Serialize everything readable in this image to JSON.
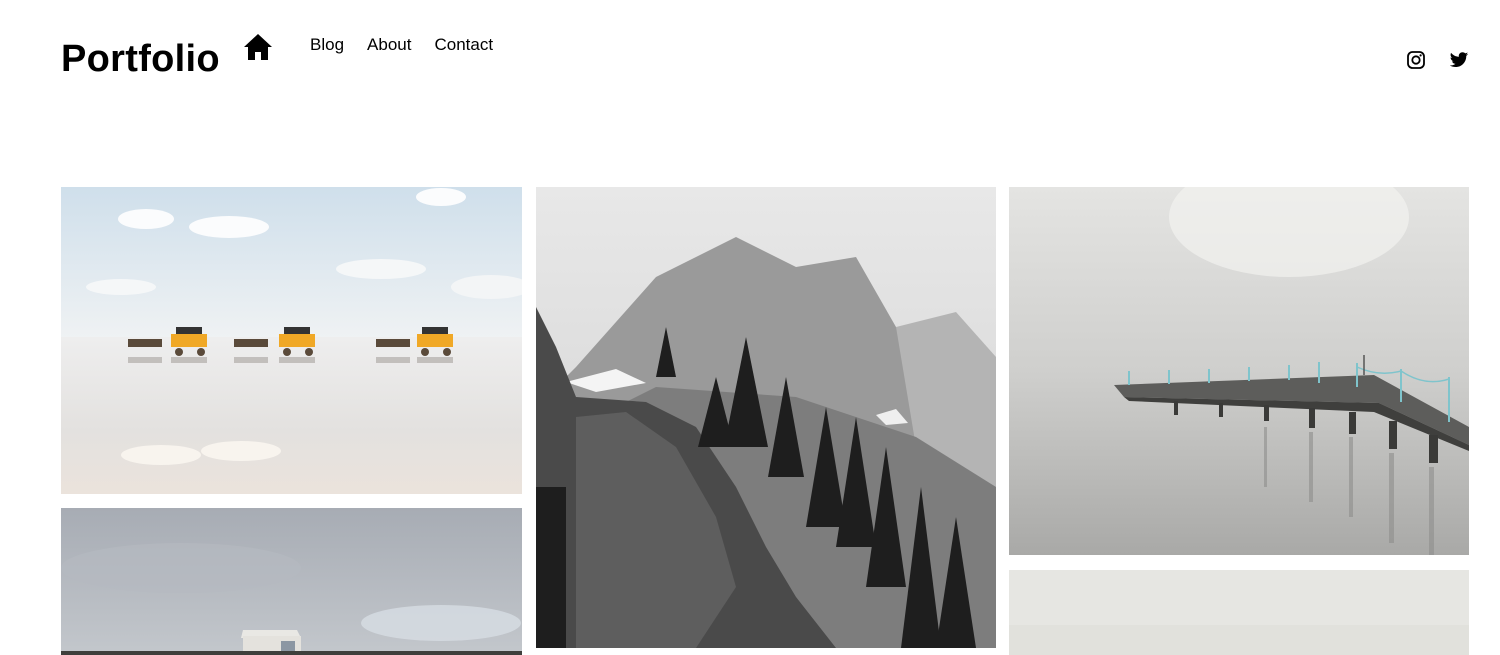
{
  "header": {
    "site_title": "Portfolio",
    "nav": [
      {
        "label": "Blog"
      },
      {
        "label": "About"
      },
      {
        "label": "Contact"
      }
    ],
    "icons": {
      "home": "home-icon",
      "instagram": "instagram-icon",
      "twitter": "twitter-icon"
    }
  },
  "gallery": {
    "images": [
      {
        "name": "wagons-on-tidal-flat",
        "colors": {
          "sky": "#dbe6ee",
          "water": "#e9e6e3",
          "wagon": "#f0a826"
        }
      },
      {
        "name": "mountain-forest-bw",
        "colors": {
          "sky": "#dcdcdc",
          "rock": "#4a4a4a"
        }
      },
      {
        "name": "pier-in-fog",
        "colors": {
          "fog": "#d8d8d6",
          "rail": "#7fc4cc"
        }
      },
      {
        "name": "hut-under-clouds",
        "colors": {
          "sky": "#aeb2ba"
        }
      },
      {
        "name": "misty-plain",
        "colors": {
          "sky": "#e6e6e2"
        }
      }
    ]
  }
}
